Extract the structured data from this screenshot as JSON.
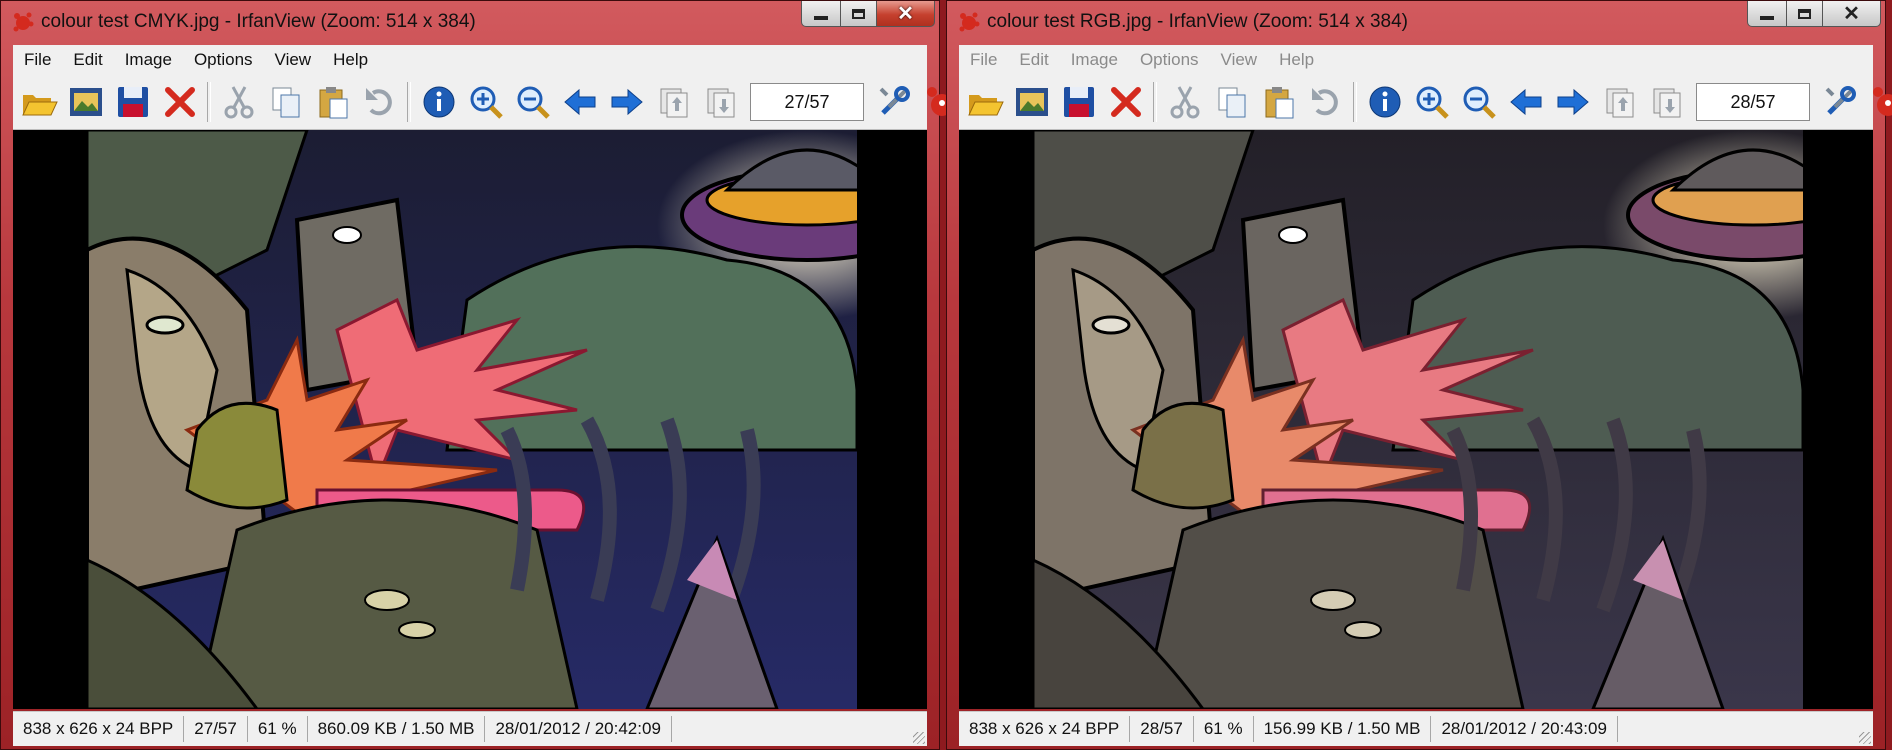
{
  "colors": {
    "titlebar": "#b8383d",
    "chrome": "#f0f0f0",
    "accent_red": "#d42a1e"
  },
  "windows": [
    {
      "id": "left",
      "title": "colour test CMYK.jpg - IrfanView (Zoom: 514 x 384)",
      "close_glyph": "✕",
      "menu": [
        "File",
        "Edit",
        "Image",
        "Options",
        "View",
        "Help"
      ],
      "toolbar_icons": [
        "open-folder-icon",
        "thumbnails-icon",
        "save-icon",
        "delete-icon",
        "cut-icon",
        "copy-icon",
        "paste-icon",
        "undo-icon",
        "info-icon",
        "zoom-in-icon",
        "zoom-out-icon",
        "previous-icon",
        "next-icon",
        "first-page-icon",
        "last-page-icon",
        "settings-icon",
        "irfanview-logo-icon"
      ],
      "page_field": "27/57",
      "status": [
        "838 x 626 x 24 BPP",
        "27/57",
        "61 %",
        "860.09 KB / 1.50 MB",
        "28/01/2012 / 20:42:09"
      ]
    },
    {
      "id": "right",
      "title": "colour test RGB.jpg - IrfanView (Zoom: 514 x 384)",
      "close_glyph": "✕",
      "menu": [
        "File",
        "Edit",
        "Image",
        "Options",
        "View",
        "Help"
      ],
      "toolbar_icons": [
        "open-folder-icon",
        "thumbnails-icon",
        "save-icon",
        "delete-icon",
        "cut-icon",
        "copy-icon",
        "paste-icon",
        "undo-icon",
        "info-icon",
        "zoom-in-icon",
        "zoom-out-icon",
        "previous-icon",
        "next-icon",
        "first-page-icon",
        "last-page-icon",
        "settings-icon",
        "irfanview-logo-icon"
      ],
      "page_field": "28/57",
      "status": [
        "838 x 626 x 24 BPP",
        "28/57",
        "61 %",
        "156.99 KB / 1.50 MB",
        "28/01/2012 / 20:43:09"
      ]
    }
  ]
}
